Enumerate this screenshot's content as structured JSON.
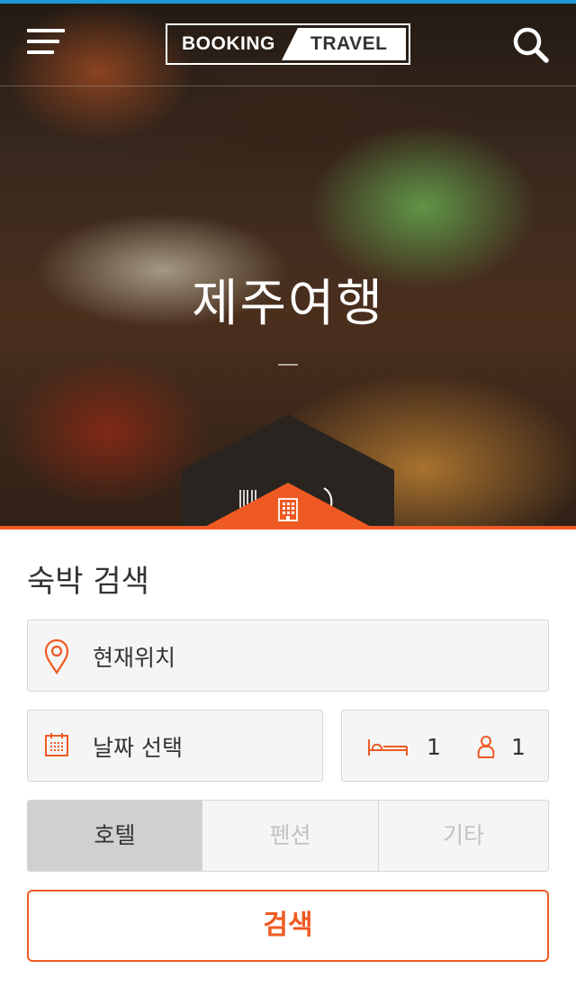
{
  "header": {
    "logo_left": "BOOKING",
    "logo_right": "TRAVEL",
    "menu_icon": "hamburger-menu-icon",
    "search_icon": "search-icon"
  },
  "hero": {
    "title": "제주여행",
    "categories": [
      {
        "icon": "utensils-icon",
        "active": false
      },
      {
        "icon": "building-icon",
        "active": true
      },
      {
        "icon": "moon-icon",
        "active": false
      }
    ]
  },
  "form": {
    "title": "숙박 검색",
    "location": {
      "icon": "map-pin-icon",
      "value": "현재위치"
    },
    "date": {
      "icon": "calendar-icon",
      "value": "날짜 선택"
    },
    "rooms": {
      "icon": "bed-icon",
      "value": "1"
    },
    "people": {
      "icon": "person-icon",
      "value": "1"
    },
    "types": [
      {
        "label": "호텔",
        "active": true
      },
      {
        "label": "펜션",
        "active": false
      },
      {
        "label": "기타",
        "active": false
      }
    ],
    "submit_label": "검색"
  },
  "colors": {
    "accent": "#ef5a22",
    "topline": "#1e9ad6",
    "field_bg": "#f5f5f5",
    "segment_active_bg": "#d0d0d0"
  }
}
